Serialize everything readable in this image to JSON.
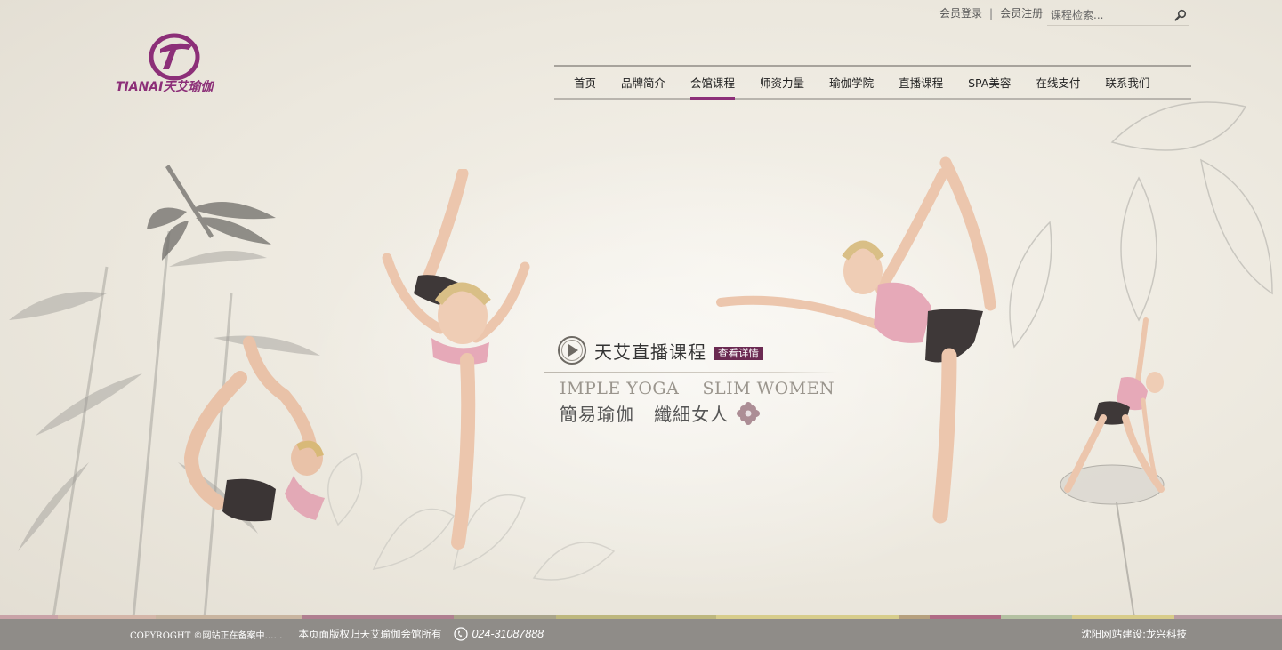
{
  "header": {
    "login_label": "会员登录",
    "separator": "|",
    "register_label": "会员注册",
    "search_placeholder": "课程检索...",
    "logo_text": "TIANAI天艾瑜伽"
  },
  "nav": {
    "items": [
      {
        "label": "首页"
      },
      {
        "label": "品牌简介"
      },
      {
        "label": "会馆课程"
      },
      {
        "label": "师资力量"
      },
      {
        "label": "瑜伽学院"
      },
      {
        "label": "直播课程"
      },
      {
        "label": "SPA美容"
      },
      {
        "label": "在线支付"
      },
      {
        "label": "联系我们"
      }
    ],
    "active_index": 2
  },
  "promo": {
    "title": "天艾直播课程",
    "button_label": "查看详情",
    "english": "IMPLE YOGA    SLIM WOMEN",
    "chinese": "簡易瑜伽   纖細女人"
  },
  "footer": {
    "copyright": "COPYROGHT ©网站正在备案中……",
    "rights": "本页面版权归天艾瑜伽会馆所有",
    "phone": "024-31087888",
    "credit": "沈阳网站建设:龙兴科技"
  },
  "colors": {
    "brand": "#8c2f78",
    "promo_button": "#6b2a52",
    "footer_bg": "#8f8c88",
    "strip": [
      "#c9a3a8",
      "#d4b6a9",
      "#c9b5a0",
      "#b07f90",
      "#a9a48a",
      "#bdb77e",
      "#d7cd8c",
      "#b6a07e",
      "#b06b85",
      "#b4c1a2",
      "#d8cc8a",
      "#b99ca4"
    ]
  },
  "icons": {
    "search": "search-icon",
    "play": "play-icon",
    "flower": "flower-icon",
    "phone": "phone-icon"
  }
}
